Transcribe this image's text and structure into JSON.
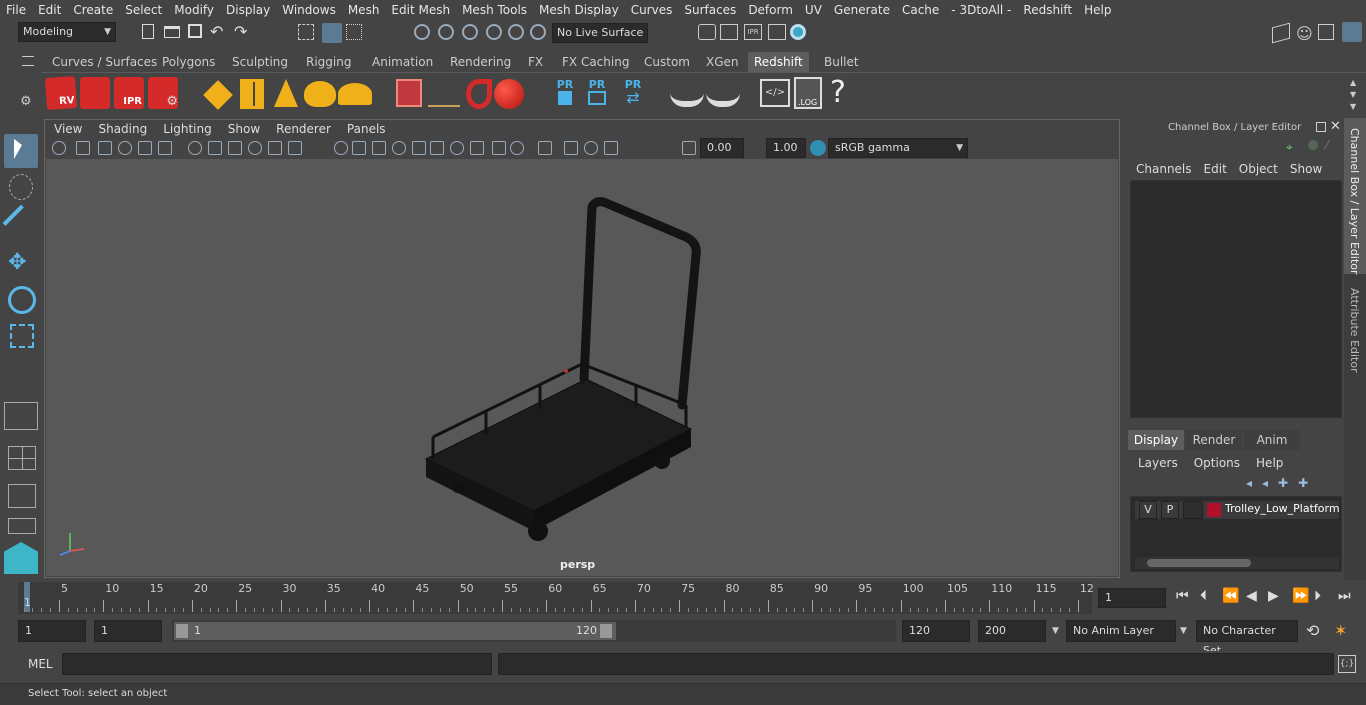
{
  "menubar": [
    "File",
    "Edit",
    "Create",
    "Select",
    "Modify",
    "Display",
    "Windows",
    "Mesh",
    "Edit Mesh",
    "Mesh Tools",
    "Mesh Display",
    "Curves",
    "Surfaces",
    "Deform",
    "UV",
    "Generate",
    "Cache",
    "- 3DtoAll -",
    "Redshift",
    "Help"
  ],
  "status": {
    "mode": "Modeling",
    "live_surface": "No Live Surface"
  },
  "shelf_tabs": [
    "Curves / Surfaces",
    "Polygons",
    "Sculpting",
    "Rigging",
    "Animation",
    "Rendering",
    "FX",
    "FX Caching",
    "Custom",
    "XGen",
    "Redshift",
    "Bullet"
  ],
  "shelf_active": "Redshift",
  "shelf_labels": {
    "rv": "RV",
    "ipr": "IPR",
    "pr1": "PR",
    "pr2": "PR",
    "pr3": "PR",
    "log": ".LOG",
    "help": "?"
  },
  "viewport": {
    "menu": [
      "View",
      "Shading",
      "Lighting",
      "Show",
      "Renderer",
      "Panels"
    ],
    "exposure": "0.00",
    "gamma": "1.00",
    "color_space": "sRGB gamma",
    "camera": "persp"
  },
  "channel_box": {
    "title": "Channel Box / Layer Editor",
    "menu": [
      "Channels",
      "Edit",
      "Object",
      "Show"
    ]
  },
  "layer_editor": {
    "tabs": [
      "Display",
      "Render",
      "Anim"
    ],
    "active_tab": "Display",
    "menu": [
      "Layers",
      "Options",
      "Help"
    ],
    "layer": {
      "v": "V",
      "p": "P",
      "name": "Trolley_Low_Platform_v",
      "color": "#b0102a"
    }
  },
  "side_tabs": [
    "Channel Box / Layer Editor",
    "Attribute Editor"
  ],
  "timeline": {
    "ticks": [
      "5",
      "10",
      "15",
      "20",
      "25",
      "30",
      "35",
      "40",
      "45",
      "50",
      "55",
      "60",
      "65",
      "70",
      "75",
      "80",
      "85",
      "90",
      "95",
      "100",
      "105",
      "110",
      "115",
      "12"
    ],
    "start_marker": "1",
    "current_frame": "1"
  },
  "range": {
    "start": "1",
    "playback_start": "1",
    "slider_start": "1",
    "slider_end": "120",
    "playback_end": "120",
    "end": "200",
    "anim_layer": "No Anim Layer",
    "character_set": "No Character Set"
  },
  "command": {
    "label": "MEL"
  },
  "help_line": "Select Tool: select an object"
}
